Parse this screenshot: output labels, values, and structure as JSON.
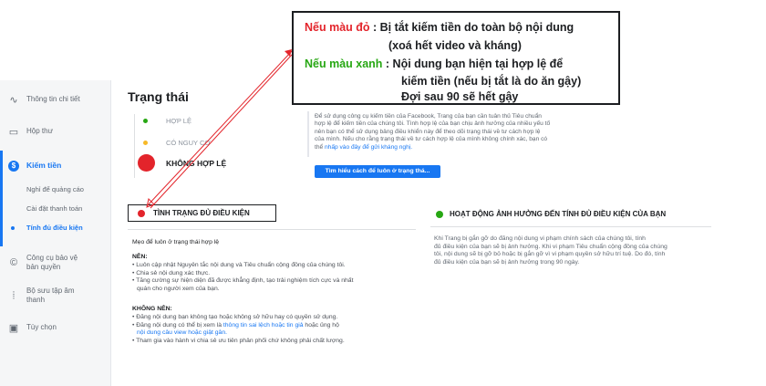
{
  "sidebar": {
    "items": [
      {
        "label": "Thông tin chi tiết",
        "icon": "insights-icon"
      },
      {
        "label": "Hộp thư",
        "icon": "inbox-icon"
      },
      {
        "label": "Kiếm tiền",
        "icon": "dollar-icon"
      },
      {
        "label": "Công cụ bảo vệ bản quyền",
        "icon": "copyright-icon"
      },
      {
        "label": "Bộ sưu tập âm thanh",
        "icon": "sound-icon"
      },
      {
        "label": "Tùy chọn",
        "icon": "settings-icon"
      }
    ],
    "subitems": [
      "Nghỉ để quảng cáo",
      "Cài đặt thanh toán",
      "Tính đủ điều kiện"
    ],
    "line2": {
      "copyright": "bản quyền",
      "sound": "thanh"
    }
  },
  "main": {
    "title": "Trạng thái",
    "lights": {
      "valid": "HỢP LỆ",
      "warning": "CÓ NGUY CƠ",
      "invalid": "KHÔNG HỢP LỆ"
    },
    "info_lines": [
      "Để sử dụng công cụ kiếm tiền của Facebook, Trang của bạn cần tuân thủ Tiêu chuẩn",
      "hợp lệ để kiếm tiền của chúng tôi. Tình hợp lệ của bạn chịu ảnh hưởng của nhiều yếu tố",
      "nên bạn có thể sử dụng bảng điều khiển này để theo dõi trạng thái về tư cách hợp lệ",
      "của mình. Nếu cho rằng trạng thái về tư cách hợp lệ của mình không chính xác, bạn có",
      "thể "
    ],
    "info_link": "nhấp vào đây để gửi kháng nghị.",
    "learn_button": "Tìm hiểu cách để luôn ở trạng thá...",
    "eligibility_title": "TÌNH TRẠNG ĐỦ ĐIỀU KIỆN",
    "activity_title": "HOẠT ĐỘNG ẢNH HƯỞNG ĐẾN TÍNH ĐỦ ĐIỀU KIỆN CỦA BẠN",
    "tips_title": "Mẹo để luôn ở trạng thái hợp lệ",
    "should_title": "NÊN:",
    "should": [
      "• Luôn cập nhật Nguyên tắc nội dung và Tiêu chuẩn cộng đồng của chúng tôi.",
      "• Chia sẻ nội dung xác thực.",
      "• Tăng cường sự hiện diện đã được khẳng định, tạo trải nghiệm tích cực và nhất",
      "  quán cho người xem của bạn."
    ],
    "should_not_title": "KHÔNG NÊN:",
    "should_not": [
      "• Đăng nội dung bạn không tạo hoặc không sở hữu hay có quyền sử dụng.",
      "• Đăng nội dung có thể bị xem là ",
      "  ",
      "• Tham gia vào hành vi chia sẻ ưu tiên phân phối chứ không phải chất lượng."
    ],
    "should_not_link1": "thông tin sai lệch hoặc tin giả",
    "should_not_mid": " hoặc ủng hộ",
    "should_not_link2": "nội dung câu view hoặc giật gân.",
    "right_lines": [
      "Khi Trang bị gắn gỡ do đăng nội dung vi phạm chính sách của chúng tôi, tính",
      "đủ điều kiện của bạn sẽ bị ảnh hưởng. Khi vi phạm Tiêu chuẩn cộng đồng của chúng",
      "tôi, nội dung sẽ bị gỡ bỏ hoặc bị gắn gỡ vì vi phạm quyền sở hữu trí tuệ. Do đó, tính",
      "đủ điều kiện của bạn sẽ bị ảnh hưởng trong 90 ngày."
    ]
  },
  "annotation": {
    "red_label": "Nếu màu đỏ",
    "red_text": " : Bị tắt kiếm tiền do toàn bộ nội dung",
    "red_text2": "(xoá hết video và kháng)",
    "green_label": "Nếu màu xanh",
    "green_text": " : Nội dung bạn hiện tại hợp lệ để",
    "green_text2": "kiếm tiền (nếu bị tắt là do ăn gậy)",
    "green_text3": "Đợi sau 90 sẽ hết gậy"
  },
  "colors": {
    "accent": "#1877f2",
    "red": "#e3242b",
    "green": "#27a713",
    "yellow": "#f7b928"
  }
}
